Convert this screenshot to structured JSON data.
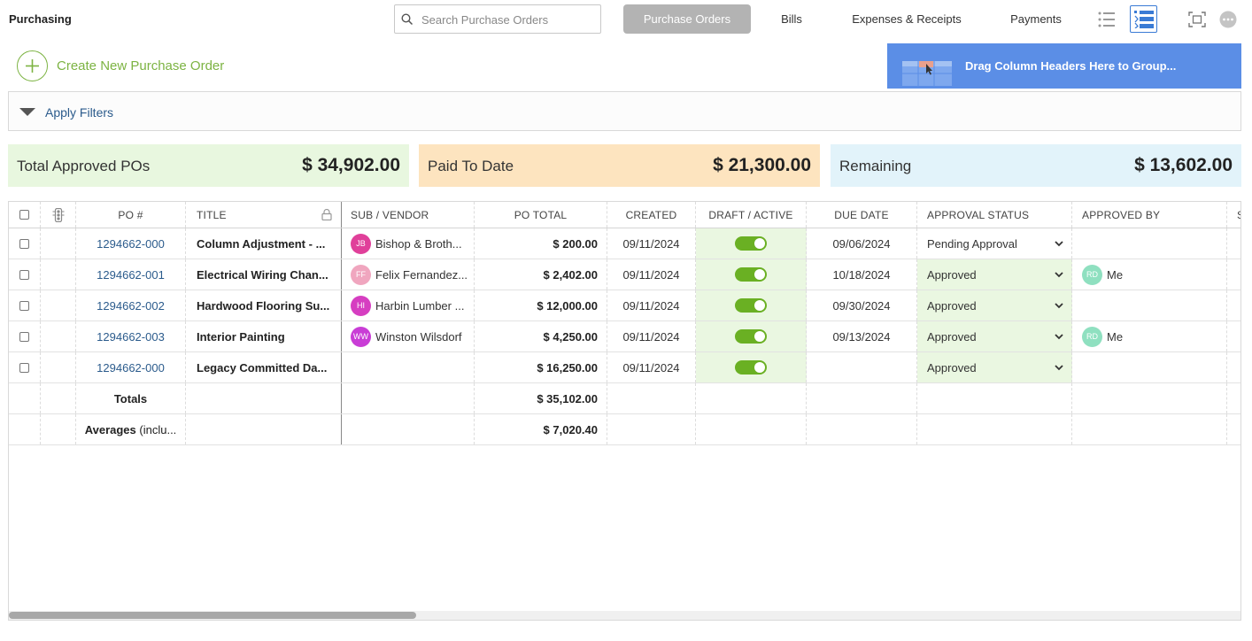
{
  "app": {
    "title": "Purchasing"
  },
  "search": {
    "placeholder": "Search Purchase Orders",
    "value": ""
  },
  "tabs": [
    {
      "label": "Purchase Orders",
      "active": true
    },
    {
      "label": "Bills",
      "active": false
    },
    {
      "label": "Expenses & Receipts",
      "active": false
    },
    {
      "label": "Payments",
      "active": false
    }
  ],
  "toolbar": {
    "icons": [
      "list-view-icon",
      "grouped-view-icon",
      "fullscreen-icon",
      "more-options-icon"
    ]
  },
  "create": {
    "label": "Create New Purchase Order"
  },
  "group": {
    "label": "Drag Column Headers Here to Group..."
  },
  "filters": {
    "label": "Apply Filters"
  },
  "summary": {
    "approved": {
      "label": "Total Approved POs",
      "value": "$ 34,902.00",
      "color": "#e8f7df"
    },
    "paid": {
      "label": "Paid To Date",
      "value": "$ 21,300.00",
      "color": "#fde4bf"
    },
    "remaining": {
      "label": "Remaining",
      "value": "$ 13,602.00",
      "color": "#e2f3fa"
    }
  },
  "table": {
    "columns": {
      "po": "PO #",
      "title": "TITLE",
      "vendor": "SUB / VENDOR",
      "total": "PO TOTAL",
      "created": "CREATED",
      "active": "DRAFT / ACTIVE",
      "due": "DUE DATE",
      "status": "APPROVAL STATUS",
      "approved_by": "APPROVED BY",
      "next": "S"
    },
    "rows": [
      {
        "po": "1294662-000",
        "title": "Column Adjustment - ...",
        "vendor_initials": "JB",
        "vendor_color": "#e0409a",
        "vendor": "Bishop & Broth...",
        "total": "$ 200.00",
        "created": "09/11/2024",
        "due": "09/06/2024",
        "status": "Pending Approval",
        "approved_by_initials": "",
        "approved_by": ""
      },
      {
        "po": "1294662-001",
        "title": "Electrical Wiring Chan...",
        "vendor_initials": "FF",
        "vendor_color": "#f0a6bf",
        "vendor": "Felix Fernandez...",
        "total": "$ 2,402.00",
        "created": "09/11/2024",
        "due": "10/18/2024",
        "status": "Approved",
        "approved_by_initials": "RD",
        "approved_by": "Me"
      },
      {
        "po": "1294662-002",
        "title": "Hardwood Flooring Su...",
        "vendor_initials": "HI",
        "vendor_color": "#d63ec1",
        "vendor": "Harbin Lumber ...",
        "total": "$ 12,000.00",
        "created": "09/11/2024",
        "due": "09/30/2024",
        "status": "Approved",
        "approved_by_initials": "",
        "approved_by": ""
      },
      {
        "po": "1294662-003",
        "title": "Interior Painting",
        "vendor_initials": "WW",
        "vendor_color": "#c93dd6",
        "vendor": "Winston Wilsdorf",
        "total": "$ 4,250.00",
        "created": "09/11/2024",
        "due": "09/13/2024",
        "status": "Approved",
        "approved_by_initials": "RD",
        "approved_by": "Me"
      },
      {
        "po": "1294662-000",
        "title": "Legacy Committed Da...",
        "vendor_initials": "",
        "vendor_color": "",
        "vendor": "",
        "total": "$ 16,250.00",
        "created": "09/11/2024",
        "due": "",
        "status": "Approved",
        "approved_by_initials": "",
        "approved_by": ""
      }
    ],
    "totals": {
      "label": "Totals",
      "value": "$ 35,102.00"
    },
    "averages": {
      "label": "Averages",
      "suffix": "(inclu...",
      "value": "$ 7,020.40"
    }
  },
  "colors": {
    "accent_green": "#7cb342",
    "toggle_green": "#6ab023",
    "link_blue": "#2b5b8c",
    "group_blue": "#5b8ee6",
    "approver_avatar": "#8fe0c0"
  }
}
